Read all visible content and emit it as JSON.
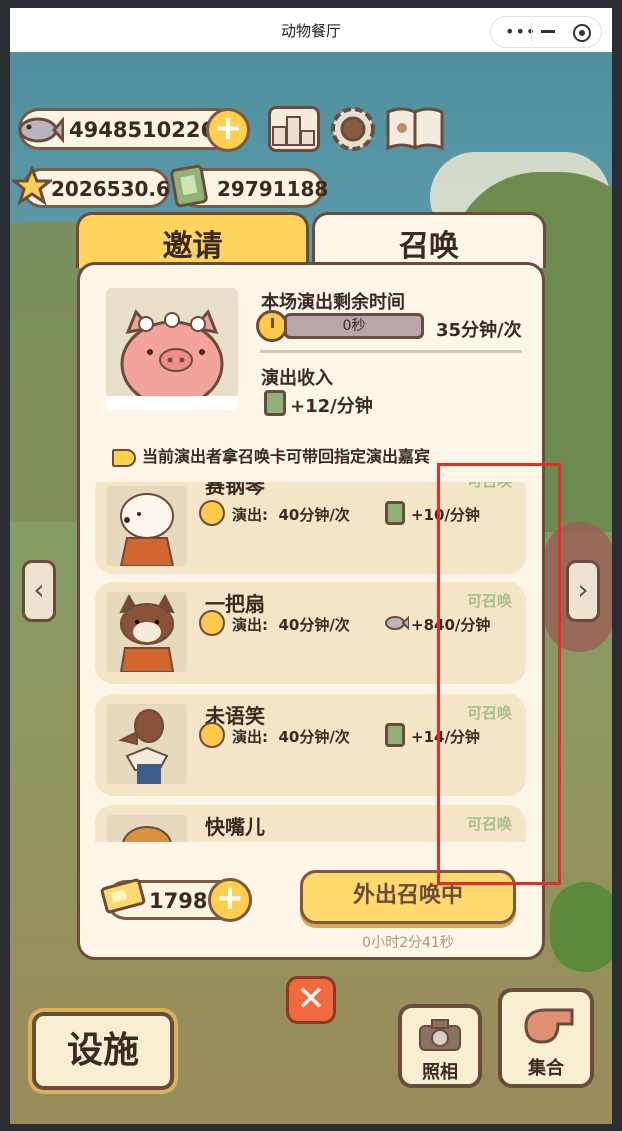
{
  "window": {
    "title": "动物餐厅"
  },
  "currencies": {
    "fish": "4948510226",
    "stars": "2026530.6",
    "tickets": "29791188"
  },
  "tabs": [
    {
      "label": "邀请",
      "active": false
    },
    {
      "label": "召唤",
      "active": true
    }
  ],
  "performance": {
    "remaining_label": "本场演出剩余时间",
    "remaining_value": "0秒",
    "duration": "35分钟/次",
    "income_label": "演出收入",
    "income_value": "+12/分钟"
  },
  "notice": "当前演出者拿召唤卡可带回指定演出嘉宾",
  "performers": [
    {
      "name": "赛钢琴",
      "status": "可召唤",
      "perform_label": "演出:",
      "perform_value": "40分钟/次",
      "reward": "+10/分钟",
      "reward_icon": "ticket-icon"
    },
    {
      "name": "一把扇",
      "status": "可召唤",
      "perform_label": "演出:",
      "perform_value": "40分钟/次",
      "reward": "+840/分钟",
      "reward_icon": "fish-icon"
    },
    {
      "name": "未语笑",
      "status": "可召唤",
      "perform_label": "演出:",
      "perform_value": "40分钟/次",
      "reward": "+14/分钟",
      "reward_icon": "ticket-icon"
    },
    {
      "name": "快嘴儿",
      "status": "可召唤",
      "perform_label": "",
      "perform_value": "",
      "reward": "",
      "reward_icon": ""
    }
  ],
  "summon_cards": "1798",
  "summon_button": "外出召唤中",
  "countdown": "0小时2分41秒",
  "bottom": {
    "facility": "设施",
    "photo": "照相",
    "gather": "集合"
  },
  "colors": {
    "accent": "#ffd45c",
    "highlight_box": "#e62b2b",
    "available": "#a6c18c"
  }
}
